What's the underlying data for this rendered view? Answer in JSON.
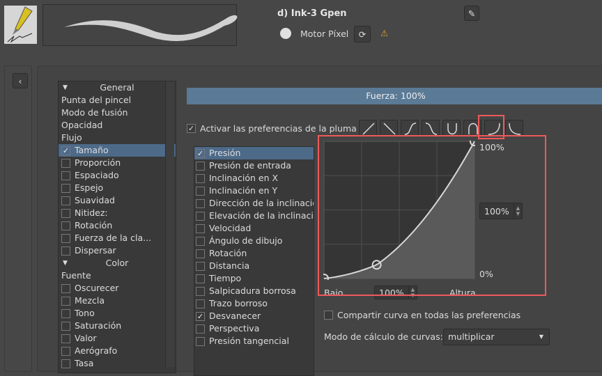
{
  "preset": {
    "name": "d) Ink-3 Gpen",
    "engine": "Motor Píxel"
  },
  "categories": [
    {
      "type": "header",
      "label": "General"
    },
    {
      "label": "Punta del pincel"
    },
    {
      "label": "Modo de fusión"
    },
    {
      "label": "Opacidad"
    },
    {
      "label": "Flujo"
    },
    {
      "label": "Tamaño",
      "checkbox": true,
      "checked": true,
      "selected": true
    },
    {
      "label": "Proporción",
      "checkbox": true
    },
    {
      "label": "Espaciado",
      "checkbox": true
    },
    {
      "label": "Espejo",
      "checkbox": true
    },
    {
      "label": "Suavidad",
      "checkbox": true
    },
    {
      "label": "Nitidez:",
      "checkbox": true
    },
    {
      "label": "Rotación",
      "checkbox": true
    },
    {
      "label": "Fuerza de la cla...",
      "checkbox": true
    },
    {
      "label": "Dispersar",
      "checkbox": true
    },
    {
      "type": "header",
      "label": "Color"
    },
    {
      "label": "Fuente"
    },
    {
      "label": "Oscurecer",
      "checkbox": true
    },
    {
      "label": "Mezcla",
      "checkbox": true
    },
    {
      "label": "Tono",
      "checkbox": true
    },
    {
      "label": "Saturación",
      "checkbox": true
    },
    {
      "label": "Valor",
      "checkbox": true
    },
    {
      "label": "Aerógrafo",
      "checkbox": true
    },
    {
      "label": "Tasa",
      "checkbox": true
    }
  ],
  "strength": {
    "label": "Fuerza: 100%",
    "value": 100
  },
  "pen_settings": {
    "label": "Activar las preferencias de la pluma",
    "checked": true
  },
  "sensors": [
    {
      "label": "Presión",
      "checked": true,
      "selected": true
    },
    {
      "label": "Presión de entrada"
    },
    {
      "label": "Inclinación en X"
    },
    {
      "label": "Inclinación en Y"
    },
    {
      "label": "Dirección de la inclinación"
    },
    {
      "label": "Elevación de la inclinación"
    },
    {
      "label": "Velocidad"
    },
    {
      "label": "Ángulo de dibujo"
    },
    {
      "label": "Rotación"
    },
    {
      "label": "Distancia"
    },
    {
      "label": "Tiempo"
    },
    {
      "label": "Salpicadura borrosa"
    },
    {
      "label": "Trazo borroso"
    },
    {
      "label": "Desvanecer",
      "checked": true
    },
    {
      "label": "Perspectiva"
    },
    {
      "label": "Presión tangencial"
    }
  ],
  "curve": {
    "points": [
      [
        0,
        0
      ],
      [
        0.35,
        0.1
      ],
      [
        1,
        1
      ]
    ],
    "top_label": "100%",
    "bottom_label": "0%",
    "max_value": "100%",
    "min_value": "100%",
    "x_left": "Bajo",
    "x_right": "Altura"
  },
  "share_curve": {
    "label": "Compartir curva en todas las preferencias",
    "checked": false
  },
  "curve_mode": {
    "label": "Modo de cálculo de curvas:",
    "value": "multiplicar"
  },
  "colors": {
    "accent": "#4d6a89",
    "highlight": "#f0595b",
    "warning": "#e0a030"
  }
}
